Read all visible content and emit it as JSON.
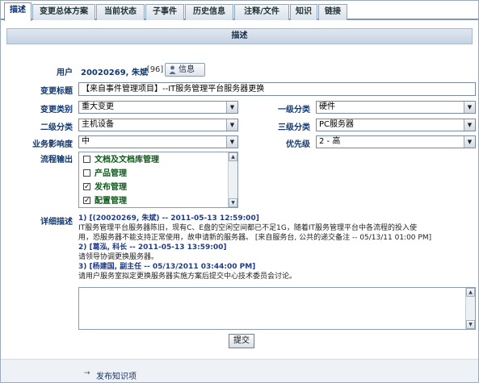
{
  "tabs": [
    "描述",
    "变更总体方案",
    "当前状态",
    "子事件",
    "历史信息",
    "注释/文件",
    "知识",
    "链接"
  ],
  "section_title": "描述",
  "user": {
    "label": "用户",
    "value": "20020269, 朱斌",
    "extra": "- [96]",
    "info_button": "信息"
  },
  "title": {
    "label": "变更标题",
    "value": "【来自事件管理项目】--IT服务管理平台服务器更换"
  },
  "change_type": {
    "label": "变更类别",
    "value": "重大变更"
  },
  "cat1": {
    "label": "一级分类",
    "value": "硬件"
  },
  "cat2": {
    "label": "二级分类",
    "value": "主机设备"
  },
  "cat3": {
    "label": "三级分类",
    "value": "PC服务器"
  },
  "impact": {
    "label": "业务影响度",
    "value": "中"
  },
  "priority": {
    "label": "优先级",
    "value": "2 - 高"
  },
  "flow": {
    "label": "流程输出",
    "items": [
      {
        "text": "文档及文档库管理",
        "checked": false
      },
      {
        "text": "产品管理",
        "checked": false
      },
      {
        "text": "发布管理",
        "checked": true
      },
      {
        "text": "配置管理",
        "checked": true
      }
    ]
  },
  "details": {
    "label": "详细描述",
    "h1": "1) [(20020269, 朱斌) -- 2011-05-13 12:59:00]",
    "b1a": "IT服务管理平台服务器陈旧，现有C、E盘的空闲空间都已不足1G，随着IT服务管理平台中各流程的投入使",
    "b1b": "用，恐服务器不能支持正常使用，故申请新的服务器。 [来自服务台, 公共的递交备注 -- 05/13/11 01:00 PM]",
    "h2": "2) [葛泓, 科长 -- 2011-05-13 13:59:00]",
    "b2": "请领导协调更换服务器。",
    "h3": "3) [杨建国, 副主任 -- 05/13/2011 03:44:00 PM]",
    "b3": "请用户服务室拟定更换服务器实施方案后提交中心技术委员会讨论。"
  },
  "submit_label": "提交",
  "publish_link": "发布知识项"
}
